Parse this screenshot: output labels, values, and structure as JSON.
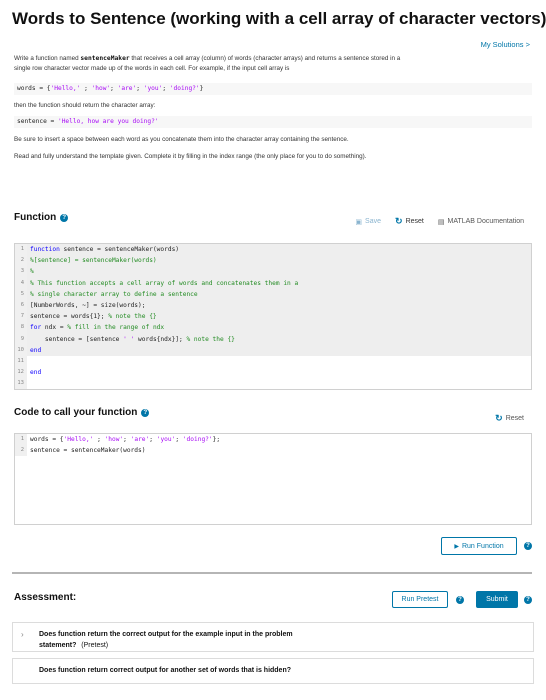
{
  "problem": {
    "title": "Words to Sentence (working with a cell array of character vectors)",
    "my_solutions": "My Solutions >",
    "desc1_a": "Write a function named ",
    "desc1_fn": "sentenceMaker",
    "desc1_b": " that receives a cell array (column) of words (character arrays) and returns a sentence stored in a",
    "desc1_c": "single row character vector made up of the words in each cell. For example, if the input cell array is",
    "code1_prefix": "words = {",
    "code1_s1": "'Hello,'",
    "code1_sep1": " ; ",
    "code1_s2": "'how'",
    "code1_sep2": "; ",
    "code1_s3": "'are'",
    "code1_sep3": "; ",
    "code1_s4": "'you'",
    "code1_sep4": "; ",
    "code1_s5": "'doing?'",
    "code1_suffix": "}",
    "desc2": "then the function should return the character array:",
    "code2_prefix": "sentence = ",
    "code2_str": "'Hello, how are you doing?'",
    "desc3": "Be sure to insert a space between each word as you concatenate them into the character array containing the sentence.",
    "desc4": "Read and fully understand the template given. Complete it by filling in the index range (the only place for you to do something)."
  },
  "function_section": {
    "title": "Function",
    "save": "Save",
    "reset": "Reset",
    "docs": "MATLAB Documentation",
    "lines": [
      {
        "n": "1",
        "parts": [
          {
            "c": "kw",
            "t": "function"
          },
          {
            "c": "",
            "t": " sentence = sentenceMaker(words)"
          }
        ]
      },
      {
        "n": "2",
        "parts": [
          {
            "c": "cm",
            "t": "%[sentence] = sentenceMaker(words)"
          }
        ]
      },
      {
        "n": "3",
        "parts": [
          {
            "c": "cm",
            "t": "%"
          }
        ]
      },
      {
        "n": "4",
        "parts": [
          {
            "c": "cm",
            "t": "% This function accepts a cell array of words and concatenates them in a"
          }
        ]
      },
      {
        "n": "5",
        "parts": [
          {
            "c": "cm",
            "t": "% single character array to define a sentence"
          }
        ]
      },
      {
        "n": "6",
        "parts": [
          {
            "c": "",
            "t": "[NumberWords, ~] = size(words);"
          }
        ]
      },
      {
        "n": "7",
        "parts": [
          {
            "c": "",
            "t": "sentence = words{1}; "
          },
          {
            "c": "cm",
            "t": "% note the {}"
          }
        ]
      },
      {
        "n": "8",
        "parts": [
          {
            "c": "kw",
            "t": "for"
          },
          {
            "c": "",
            "t": " ndx = "
          },
          {
            "c": "cm",
            "t": "% fill in the range of ndx"
          }
        ]
      },
      {
        "n": "9",
        "parts": [
          {
            "c": "",
            "t": "    sentence = [sentence "
          },
          {
            "c": "str",
            "t": "' '"
          },
          {
            "c": "",
            "t": " words{ndx}]; "
          },
          {
            "c": "cm",
            "t": "% note the {}"
          }
        ]
      },
      {
        "n": "10",
        "parts": [
          {
            "c": "kw",
            "t": "end"
          }
        ]
      },
      {
        "n": "11",
        "parts": [
          {
            "c": "",
            "t": ""
          }
        ]
      },
      {
        "n": "12",
        "parts": [
          {
            "c": "kw",
            "t": "end"
          }
        ]
      },
      {
        "n": "13",
        "parts": [
          {
            "c": "",
            "t": ""
          }
        ]
      }
    ]
  },
  "call_section": {
    "title": "Code to call your function",
    "reset": "Reset",
    "lines": [
      {
        "n": "1",
        "parts": [
          {
            "c": "",
            "t": "words = {"
          },
          {
            "c": "str",
            "t": "'Hello,'"
          },
          {
            "c": "",
            "t": " ; "
          },
          {
            "c": "str",
            "t": "'how'"
          },
          {
            "c": "",
            "t": "; "
          },
          {
            "c": "str",
            "t": "'are'"
          },
          {
            "c": "",
            "t": "; "
          },
          {
            "c": "str",
            "t": "'you'"
          },
          {
            "c": "",
            "t": "; "
          },
          {
            "c": "str",
            "t": "'doing?'"
          },
          {
            "c": "",
            "t": "};"
          }
        ]
      },
      {
        "n": "2",
        "parts": [
          {
            "c": "",
            "t": "sentence = sentenceMaker(words)"
          }
        ]
      }
    ],
    "run_function": "Run Function"
  },
  "assessment": {
    "title": "Assessment:",
    "run_pretest": "Run Pretest",
    "submit": "Submit",
    "test1_title": "Does function return the correct output for the example input in the problem",
    "test1_title2": "statement?",
    "test1_tag": "(Pretest)",
    "test2_title": "Does function return correct output for another set of words that is hidden?"
  },
  "icons": {
    "help": "?",
    "reset": "↻",
    "save": "▣",
    "docs": "▤",
    "play": "▶",
    "chevron": "›"
  },
  "colors": {
    "accent": "#0076a8",
    "string": "#a709f5",
    "keyword": "#0e00ff",
    "comment": "#228b22"
  }
}
